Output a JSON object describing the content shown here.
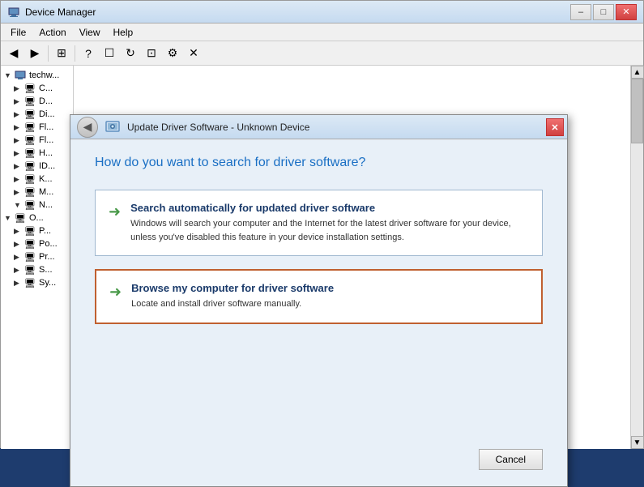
{
  "window": {
    "title": "Device Manager",
    "title_icon": "computer-icon",
    "min_btn": "–",
    "max_btn": "□",
    "close_btn": "✕"
  },
  "menu": {
    "items": [
      {
        "label": "File",
        "id": "file"
      },
      {
        "label": "Action",
        "id": "action"
      },
      {
        "label": "View",
        "id": "view"
      },
      {
        "label": "Help",
        "id": "help"
      }
    ]
  },
  "toolbar": {
    "buttons": [
      "◀",
      "▶",
      "⊞",
      "?",
      "☐",
      "↻",
      "⊡",
      "⚙",
      "✕"
    ]
  },
  "tree": {
    "items": [
      {
        "label": "techw...",
        "level": 0,
        "expanded": true,
        "icon": "computer"
      },
      {
        "label": "C...",
        "level": 1,
        "expanded": false,
        "icon": "device"
      },
      {
        "label": "D...",
        "level": 1,
        "expanded": false,
        "icon": "device"
      },
      {
        "label": "Di...",
        "level": 1,
        "expanded": false,
        "icon": "device"
      },
      {
        "label": "Fl...",
        "level": 1,
        "expanded": false,
        "icon": "device"
      },
      {
        "label": "Fl...",
        "level": 1,
        "expanded": false,
        "icon": "device"
      },
      {
        "label": "H...",
        "level": 1,
        "expanded": false,
        "icon": "device"
      },
      {
        "label": "ID...",
        "level": 1,
        "expanded": false,
        "icon": "device"
      },
      {
        "label": "K...",
        "level": 1,
        "expanded": false,
        "icon": "device"
      },
      {
        "label": "M...",
        "level": 1,
        "expanded": false,
        "icon": "device"
      },
      {
        "label": "N...",
        "level": 1,
        "expanded": true,
        "icon": "device"
      },
      {
        "label": "O...",
        "level": 0,
        "expanded": true,
        "icon": "device"
      },
      {
        "label": "P...",
        "level": 1,
        "expanded": false,
        "icon": "device"
      },
      {
        "label": "Po...",
        "level": 1,
        "expanded": false,
        "icon": "device"
      },
      {
        "label": "Pr...",
        "level": 1,
        "expanded": false,
        "icon": "device"
      },
      {
        "label": "S...",
        "level": 1,
        "expanded": false,
        "icon": "device"
      },
      {
        "label": "Sy...",
        "level": 1,
        "expanded": false,
        "icon": "device"
      }
    ]
  },
  "dialog": {
    "title": "Update Driver Software - Unknown Device",
    "close_btn": "✕",
    "back_btn": "◀",
    "driver_icon": "driver-icon",
    "question": "How do you want to search for driver software?",
    "options": [
      {
        "id": "auto",
        "title": "Search automatically for updated driver software",
        "description": "Windows will search your computer and the Internet for the latest driver software for your device, unless you've disabled this feature in your device installation settings.",
        "selected": false
      },
      {
        "id": "manual",
        "title": "Browse my computer for driver software",
        "description": "Locate and install driver software manually.",
        "selected": true
      }
    ],
    "cancel_label": "Cancel"
  }
}
